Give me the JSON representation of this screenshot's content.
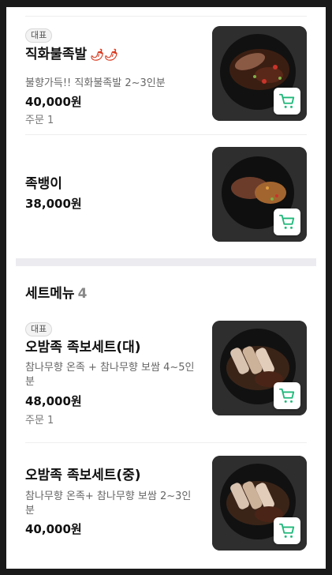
{
  "menu": {
    "items_top": [
      {
        "badge": "대표",
        "name": "직화불족발",
        "spicy_icon": "chili-pepper-icon",
        "desc": "불향가득!! 직화불족발 2~3인분",
        "price": "40,000원",
        "orders": "주문 1"
      },
      {
        "name": "족뱅이",
        "price": "38,000원"
      }
    ],
    "set_section": {
      "title": "세트메뉴",
      "count": "4",
      "items": [
        {
          "badge": "대표",
          "name": "오밤족 족보세트(대)",
          "desc": "참나무향 온족 + 참나무향 보쌈 4~5인분",
          "price": "48,000원",
          "orders": "주문 1"
        },
        {
          "name": "오밤족 족보세트(중)",
          "desc": "참나무향 온족+ 참나무향 보쌈 2~3인분",
          "price": "40,000원"
        }
      ]
    },
    "cart_icon": "cart-icon",
    "colors": {
      "cart": "#1fb87a",
      "chili": "#d9391f",
      "divider": "#ececf0"
    }
  }
}
